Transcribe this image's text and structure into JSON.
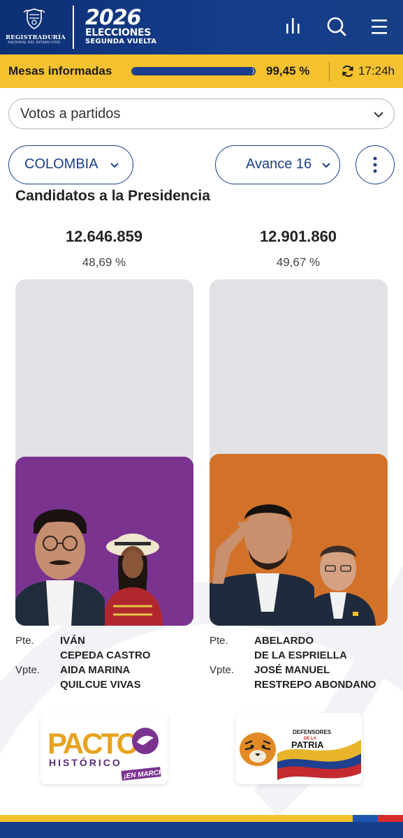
{
  "header": {
    "registry_logo_line1": "REGISTRADURÍA",
    "registry_logo_line2": "NACIONAL DEL ESTADO CIVIL",
    "election_year": "2026",
    "election_title": "ELECCIONES",
    "election_subtitle": "SEGUNDA VUELTA",
    "icons": [
      "stats-icon",
      "search-icon",
      "menu-icon"
    ]
  },
  "status": {
    "mesas_label": "Mesas informadas",
    "progress_percent": 99.45,
    "percent_text": "99,45 %",
    "time": "17:24h"
  },
  "filters": {
    "votes_select": "Votos a partidos",
    "region": "COLOMBIA",
    "bulletin": "Avance 16"
  },
  "section_title": "Candidatos a la Presidencia",
  "candidates": [
    {
      "votes": "12.646.859",
      "percent": "48,69 %",
      "pres_role": "Pte.",
      "pres_line1": "IVÁN",
      "pres_line2": "CEPEDA CASTRO",
      "vice_role": "Vpte.",
      "vice_line1": "AIDA MARINA",
      "vice_line2": "QUILCUE VIVAS",
      "party_word1": "PACTO",
      "party_word2": "HISTÓRICO",
      "party_word3": "¡EN MARCHA!",
      "color": "#7a3490"
    },
    {
      "votes": "12.901.860",
      "percent": "49,67 %",
      "pres_role": "Pte.",
      "pres_line1": "ABELARDO",
      "pres_line2": "DE LA ESPRIELLA",
      "vice_role": "Vpte.",
      "vice_line1": "JOSÉ MANUEL",
      "vice_line2": "RESTREPO ABONDANO",
      "party_word1": "DEFENSORES",
      "party_word2": "DE LA",
      "party_word3": "PATRIA",
      "color": "#d27229"
    }
  ],
  "colors": {
    "navy": "#143e8c",
    "yellow": "#f4c12f"
  }
}
